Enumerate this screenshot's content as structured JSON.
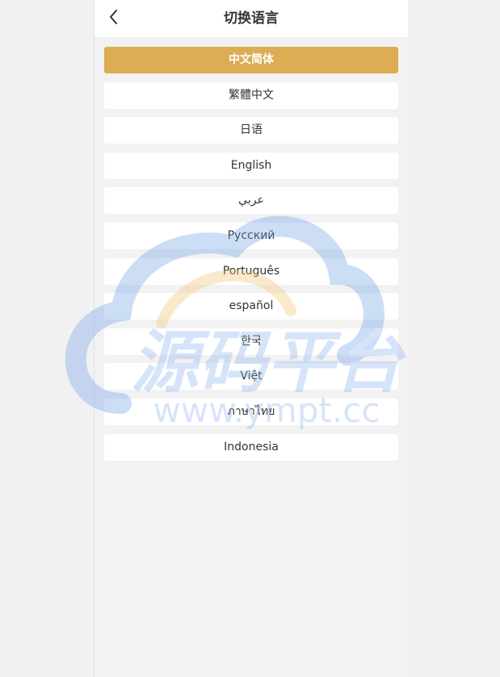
{
  "header": {
    "title": "切换语言",
    "back_icon": "chevron-left-icon"
  },
  "languages": [
    {
      "label": "中文简体",
      "selected": true
    },
    {
      "label": "繁體中文",
      "selected": false
    },
    {
      "label": "日语",
      "selected": false
    },
    {
      "label": "English",
      "selected": false
    },
    {
      "label": "عربي",
      "selected": false
    },
    {
      "label": "Русский",
      "selected": false
    },
    {
      "label": "Português",
      "selected": false
    },
    {
      "label": "español",
      "selected": false
    },
    {
      "label": "한국",
      "selected": false
    },
    {
      "label": "Việt",
      "selected": false
    },
    {
      "label": "ภาษาไทย",
      "selected": false
    },
    {
      "label": "Indonesia",
      "selected": false
    }
  ],
  "watermark": {
    "text_cn": "源码平台",
    "text_url": "www.ympt.cc"
  },
  "colors": {
    "accent": "#ddad53",
    "background": "#f2f2f2",
    "item_background": "#ffffff",
    "text": "#333333"
  }
}
